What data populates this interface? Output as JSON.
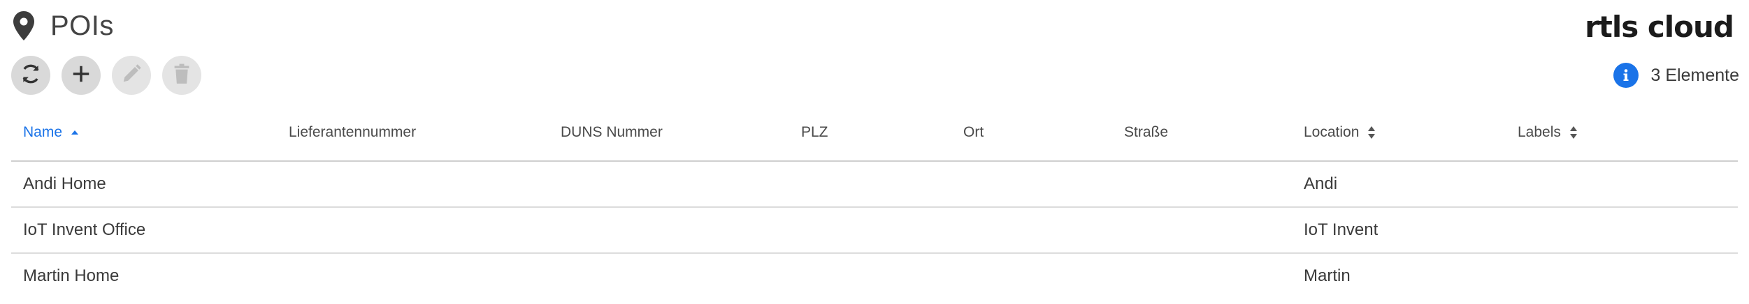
{
  "header": {
    "title": "POIs",
    "icon": "map-pin-icon"
  },
  "logo": {
    "text": "rtls cloud"
  },
  "toolbar": {
    "buttons": [
      {
        "name": "refresh",
        "icon": "refresh-icon",
        "enabled": true
      },
      {
        "name": "add",
        "icon": "plus-icon",
        "enabled": true
      },
      {
        "name": "edit",
        "icon": "pencil-icon",
        "enabled": false
      },
      {
        "name": "delete",
        "icon": "trash-icon",
        "enabled": false
      }
    ]
  },
  "info": {
    "icon": "info-icon",
    "count_text": "3 Elemente"
  },
  "table": {
    "columns": [
      {
        "label": "Name",
        "sort": "ascending"
      },
      {
        "label": "Lieferantennummer"
      },
      {
        "label": "DUNS Nummer"
      },
      {
        "label": "PLZ"
      },
      {
        "label": "Ort"
      },
      {
        "label": "Straße"
      },
      {
        "label": "Location",
        "sort": "sortable"
      },
      {
        "label": "Labels",
        "sort": "sortable"
      }
    ],
    "rows": [
      {
        "name": "Andi Home",
        "lieferantennummer": "",
        "duns": "",
        "plz": "",
        "ort": "",
        "strasse": "",
        "location": "Andi",
        "labels": ""
      },
      {
        "name": "IoT Invent Office",
        "lieferantennummer": "",
        "duns": "",
        "plz": "",
        "ort": "",
        "strasse": "",
        "location": "IoT Invent",
        "labels": ""
      },
      {
        "name": "Martin Home",
        "lieferantennummer": "",
        "duns": "",
        "plz": "",
        "ort": "",
        "strasse": "",
        "location": "Martin",
        "labels": ""
      }
    ]
  },
  "colors": {
    "accent": "#1a73e8",
    "button_bg": "#d9d9d9",
    "text": "#3a3a3a"
  }
}
